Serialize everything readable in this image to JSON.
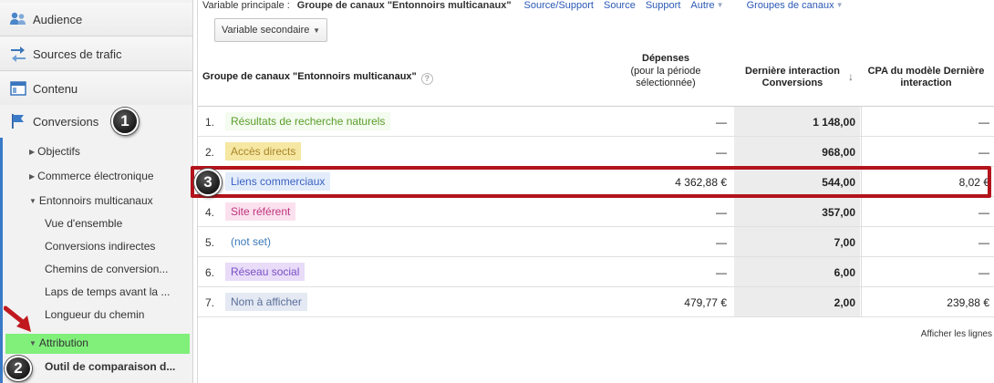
{
  "sidebar": {
    "sections": [
      {
        "id": "audience",
        "label": "Audience",
        "icon": "audience-icon"
      },
      {
        "id": "traffic",
        "label": "Sources de trafic",
        "icon": "traffic-sources-icon"
      },
      {
        "id": "content",
        "label": "Contenu",
        "icon": "content-icon"
      },
      {
        "id": "conversions",
        "label": "Conversions",
        "icon": "flag-icon"
      }
    ],
    "conversions_items": {
      "objectives": "Objectifs",
      "ecommerce": "Commerce électronique",
      "funnels": "Entonnoirs multicanaux",
      "overview": "Vue d'ensemble",
      "assisted": "Conversions indirectes",
      "paths": "Chemins de conversion...",
      "time_lag": "Laps de temps avant la ...",
      "path_length": "Longueur du chemin",
      "attribution": "Attribution",
      "comparison_tool": "Outil de comparaison d..."
    }
  },
  "annotations": {
    "badge1": "1",
    "badge2": "2",
    "badge3": "3"
  },
  "topbar": {
    "primary_label": "Variable principale :",
    "primary_value": "Groupe de canaux \"Entonnoirs multicanaux\"",
    "links": [
      "Source/Support",
      "Source",
      "Support"
    ],
    "other": "Autre",
    "groups": "Groupes de canaux"
  },
  "secondary_variable": "Variable secondaire",
  "table": {
    "headers": {
      "group": "Groupe de canaux \"Entonnoirs multicanaux\"",
      "help": "?",
      "spend_title": "Dépenses",
      "spend_sub": "(pour la période sélectionnée)",
      "last_interaction": "Dernière interaction Conversions",
      "cpa": "CPA du modèle Dernière interaction",
      "sort_arrow": "↓"
    },
    "rows": [
      {
        "num": "1.",
        "label": "Résultats de recherche naturels",
        "spend": "—",
        "conversions": "1 148,00",
        "cpa": "—",
        "text_color": "#5a9e2b",
        "chip_bg": "#f4fbef"
      },
      {
        "num": "2.",
        "label": "Accès directs",
        "spend": "—",
        "conversions": "968,00",
        "cpa": "—",
        "text_color": "#a8862a",
        "chip_bg": "#f6e7a3"
      },
      {
        "num": "3.",
        "label": "Liens commerciaux",
        "spend": "4 362,88 €",
        "conversions": "544,00",
        "cpa": "8,02 €",
        "text_color": "#3b62c4",
        "chip_bg": "#e3ecfa"
      },
      {
        "num": "4.",
        "label": "Site référent",
        "spend": "—",
        "conversions": "357,00",
        "cpa": "—",
        "text_color": "#c0347e",
        "chip_bg": "#fbe1ee"
      },
      {
        "num": "5.",
        "label": "(not set)",
        "spend": "—",
        "conversions": "7,00",
        "cpa": "—",
        "text_color": "#3b78b8",
        "chip_bg": "#ffffff"
      },
      {
        "num": "6.",
        "label": "Réseau social",
        "spend": "—",
        "conversions": "6,00",
        "cpa": "—",
        "text_color": "#7b4fc7",
        "chip_bg": "#e8dcf8"
      },
      {
        "num": "7.",
        "label": "Nom à afficher",
        "spend": "479,77 €",
        "conversions": "2,00",
        "cpa": "239,88 €",
        "text_color": "#5a6f9a",
        "chip_bg": "#e4e9f3"
      }
    ]
  },
  "footer": {
    "show_rows": "Afficher les lignes"
  },
  "colors": {
    "highlight_box": "#b3131b",
    "attribution_highlight": "#80f07b",
    "conversions_accent": "#3a7bc8"
  }
}
